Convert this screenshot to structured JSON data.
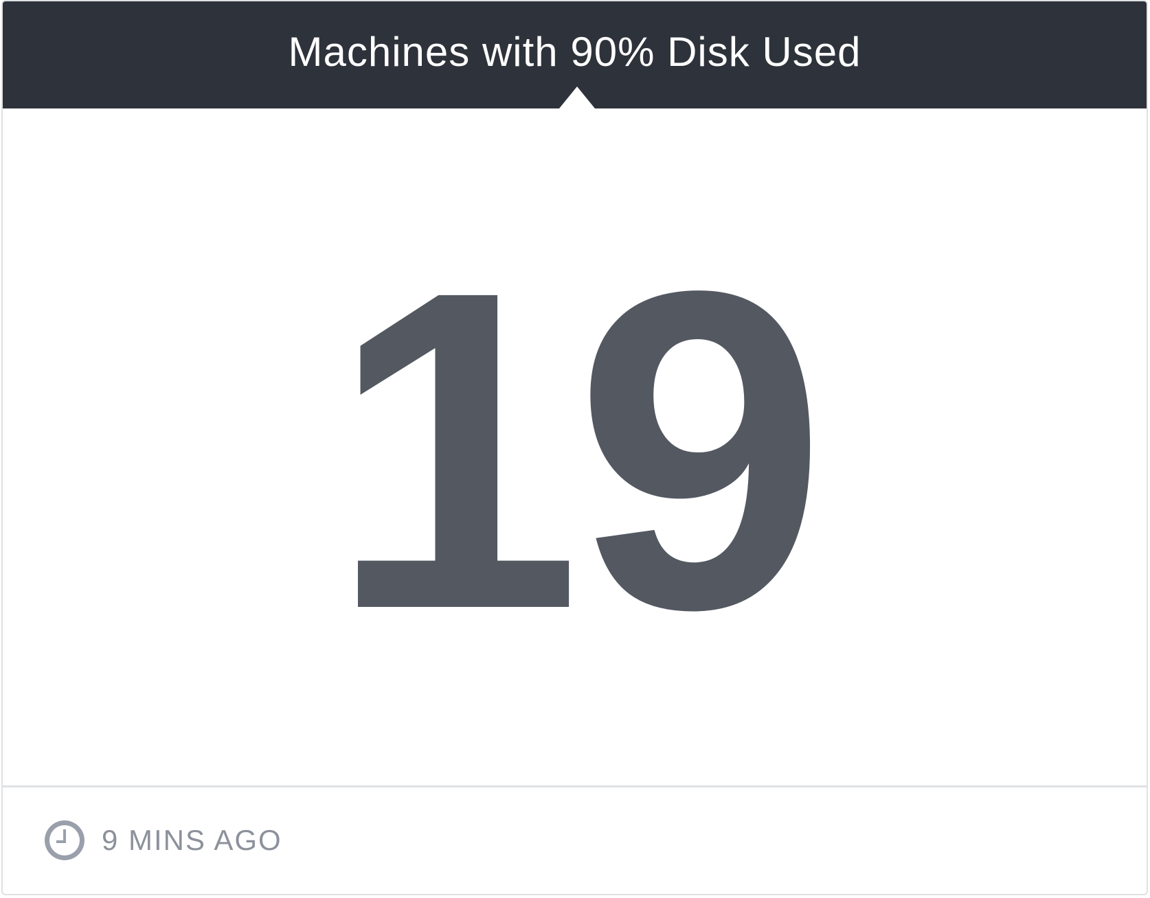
{
  "widget": {
    "title": "Machines with 90% Disk Used",
    "value": "19",
    "updated": "9 MINS AGO",
    "icon": "clock-icon"
  },
  "colors": {
    "header_bg": "#2e323a",
    "header_text": "#ffffff",
    "value_text": "#535861",
    "footer_text": "#8c919b",
    "border": "#dfe1e3"
  }
}
